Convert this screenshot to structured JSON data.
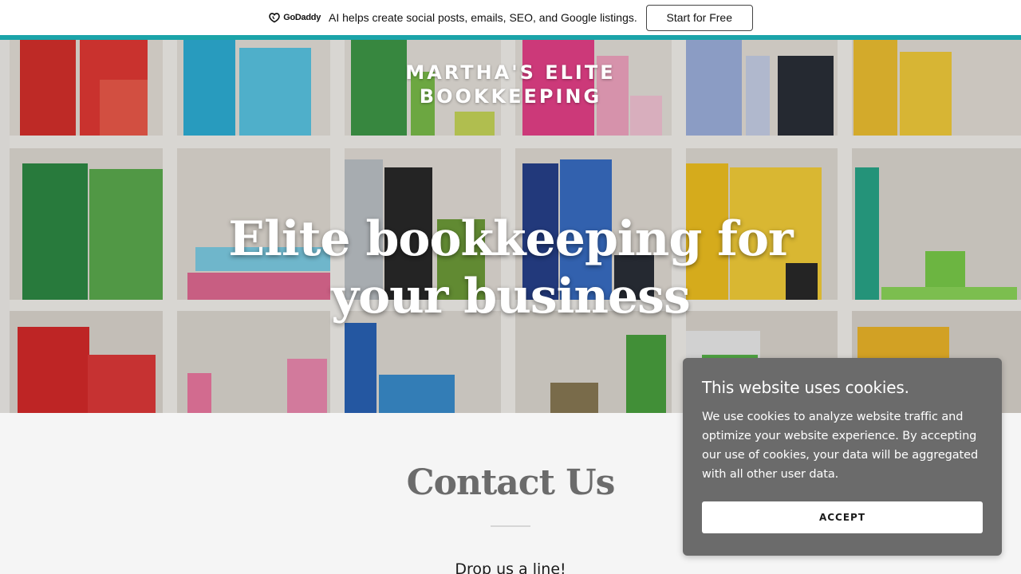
{
  "promo": {
    "brand": "GoDaddy",
    "text": "AI helps create social posts, emails, SEO, and Google listings.",
    "cta": "Start for Free",
    "accent_color": "#1ba4a9"
  },
  "header": {
    "logo_line1": "MARTHA'S ELITE",
    "logo_line2": "BOOKKEEPING"
  },
  "hero": {
    "title": "Elite bookkeeping for your business",
    "background": "shelves-with-colorful-binders"
  },
  "contact": {
    "title": "Contact Us",
    "subtitle": "Drop us a line!"
  },
  "cookie": {
    "title": "This website uses cookies.",
    "body": "We use cookies to analyze website traffic and optimize your website experience. By accepting our use of cookies, your data will be aggregated with all other user data.",
    "accept": "ACCEPT"
  }
}
